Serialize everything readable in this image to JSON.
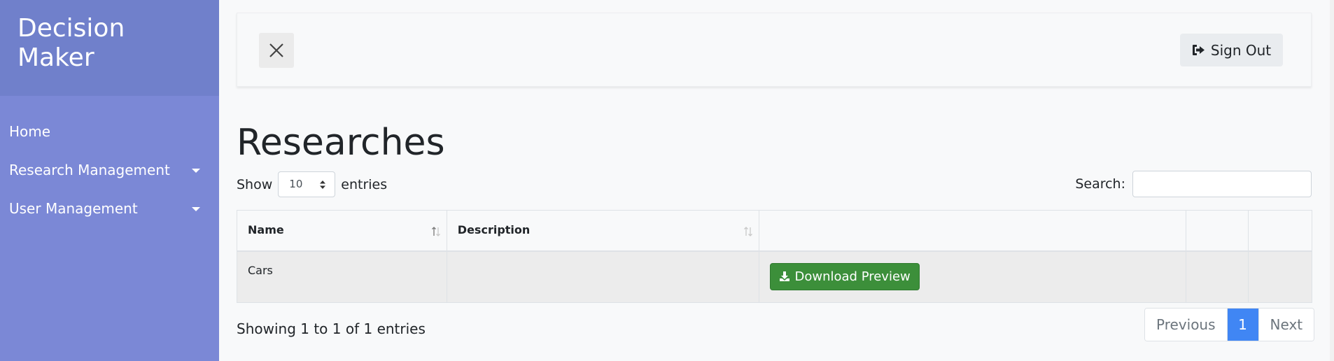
{
  "app": {
    "title": "Decision Maker"
  },
  "sidebar": {
    "items": [
      {
        "label": "Home",
        "has_dropdown": false
      },
      {
        "label": "Research Management",
        "has_dropdown": true
      },
      {
        "label": "User Management",
        "has_dropdown": true
      }
    ]
  },
  "topbar": {
    "close_icon": "close-icon",
    "signout_label": "Sign Out",
    "signout_icon": "sign-out-icon"
  },
  "page": {
    "title": "Researches"
  },
  "table_controls": {
    "show_label": "Show",
    "entries_label": "entries",
    "page_length": "10",
    "search_label": "Search:",
    "search_value": ""
  },
  "table": {
    "columns": [
      "Name",
      "Description",
      "",
      "",
      ""
    ],
    "rows": [
      {
        "name": "Cars",
        "description": "",
        "action_label": "Download Preview"
      }
    ]
  },
  "footer": {
    "info": "Showing 1 to 1 of 1 entries",
    "pagination": {
      "previous": "Previous",
      "current": "1",
      "next": "Next"
    }
  },
  "colors": {
    "sidebar": "#7b88d6",
    "brand": "#7080cb",
    "download_button": "#3c8f3a",
    "active_page": "#4086f4"
  }
}
